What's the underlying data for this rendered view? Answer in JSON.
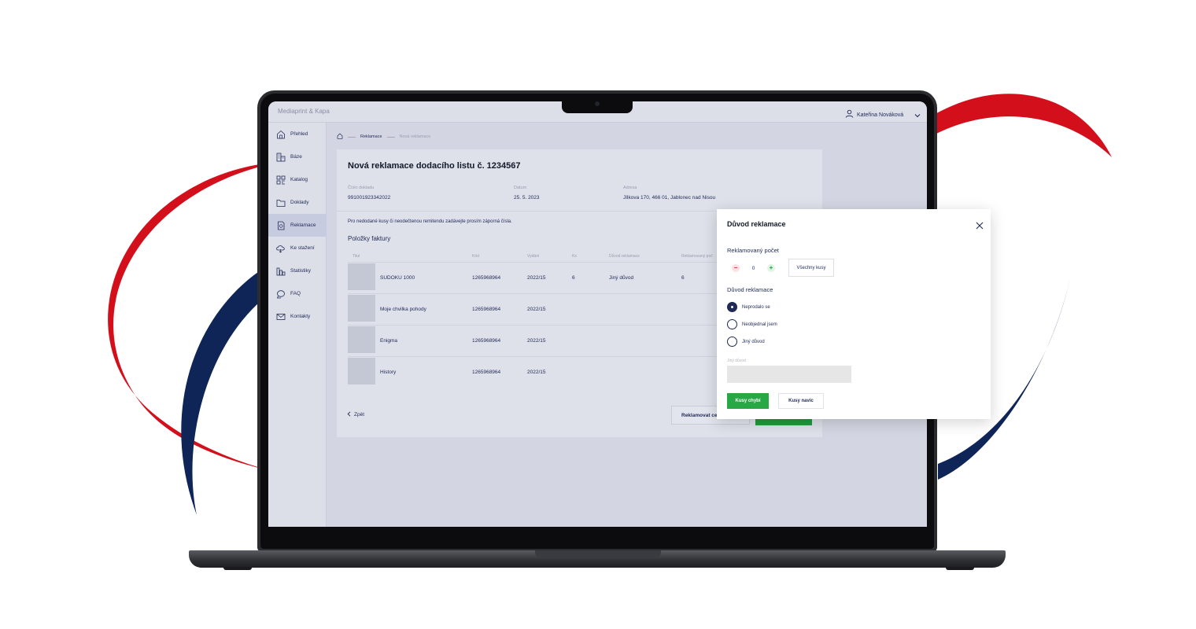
{
  "app": {
    "brand": "Mediaprint & Kapa",
    "user_name": "Kateřina Nováková"
  },
  "colors": {
    "navy": "#1f2a55",
    "brand_red": "#d30f1b",
    "brand_blue": "#0f2457",
    "accent_green": "#28a745",
    "minus_red": "#d42222"
  },
  "icons": {
    "user": "user-icon",
    "dropdown": "chevron-down-icon",
    "home": "home-icon",
    "close": "close-icon",
    "back": "chevron-left-icon"
  },
  "sidebar": {
    "items": [
      {
        "label": "Přehled",
        "icon": "home-icon",
        "active": false
      },
      {
        "label": "Báze",
        "icon": "buildings-icon",
        "active": false
      },
      {
        "label": "Katalog",
        "icon": "qr-icon",
        "active": false
      },
      {
        "label": "Doklady",
        "icon": "folder-icon",
        "active": false
      },
      {
        "label": "Reklamace",
        "icon": "document-icon",
        "active": true
      },
      {
        "label": "Ke stažení",
        "icon": "cloud-download-icon",
        "active": false
      },
      {
        "label": "Statistiky",
        "icon": "chart-icon",
        "active": false
      },
      {
        "label": "FAQ",
        "icon": "chat-icon",
        "active": false
      },
      {
        "label": "Kontakty",
        "icon": "mail-icon",
        "active": false
      }
    ]
  },
  "breadcrumb": {
    "link": "Reklamace",
    "current": "Nová reklamace"
  },
  "card": {
    "title": "Nová reklamace dodacího listu č. 1234567",
    "meta": {
      "doc_label": "Číslo dokladu",
      "doc_value": "991001923342022",
      "date_label": "Datum",
      "date_value": "25. 5. 2023",
      "address_label": "Adresa",
      "address_value": "Jílkova 170, 466 01, Jablonec nad Nisou"
    },
    "note": "Pro nedodané kusy či neodečtenou remitendu zadávejte prosím záporná čísla.",
    "section_title": "Položky faktury",
    "table": {
      "headers": [
        "Titul",
        "Kód",
        "Vydání",
        "Ks",
        "Důvod reklamace",
        "Reklamovaný poč"
      ],
      "rows": [
        {
          "title": "SUDOKU 1000",
          "code": "1265968964",
          "issue": "2022/15",
          "qty": "6",
          "reason": "Jiný důvod",
          "claimed": "6"
        },
        {
          "title": "Moje chvilka pohody",
          "code": "1265968964",
          "issue": "2022/15",
          "qty": "",
          "reason": "",
          "claimed": ""
        },
        {
          "title": "Enigma",
          "code": "1265968964",
          "issue": "2022/15",
          "qty": "",
          "reason": "",
          "claimed": ""
        },
        {
          "title": "History",
          "code": "1265968964",
          "issue": "2022/15",
          "qty": "",
          "reason": "",
          "claimed": ""
        }
      ]
    },
    "back_label": "Zpět",
    "claim_all_label": "Reklamovat cel"
  },
  "modal": {
    "title": "Důvod reklamace",
    "count_label": "Reklamovaný počet",
    "count_value": "0",
    "all_pieces_label": "Všechny kusy",
    "reason_label": "Důvod reklamace",
    "options": [
      {
        "label": "Neprodalo se",
        "checked": true
      },
      {
        "label": "Neobjednal jsem",
        "checked": false
      },
      {
        "label": "Jiný důvod",
        "checked": false
      }
    ],
    "other_label": "Jiný důvod",
    "other_value": "",
    "missing_button": "Kusy chybí",
    "extra_button": "Kusy navíc"
  }
}
